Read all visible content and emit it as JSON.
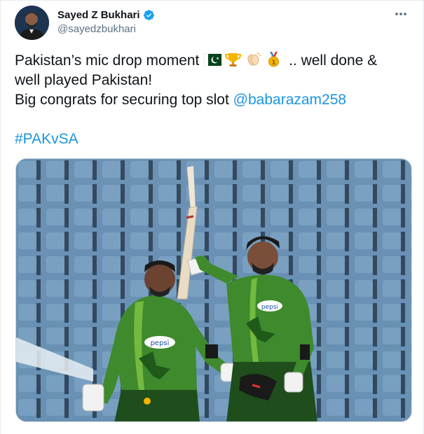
{
  "author": {
    "display_name": "Sayed Z Bukhari",
    "handle": "@sayedzbukhari",
    "verified": true
  },
  "tweet": {
    "line1_text": "Pakistan’s mic drop moment",
    "line1_emojis": [
      "pakistan-flag",
      "trophy",
      "clapping-hands",
      "first-place-medal"
    ],
    "line1_tail": " .. well done &",
    "line2": "well played Pakistan!",
    "line3_text": "Big congrats for securing top slot ",
    "mention": "@babarazam258",
    "hashtag": "#PAKvSA"
  },
  "media": {
    "shirt_brand": "pepsi"
  },
  "colors": {
    "link": "#1b95e0",
    "verified": "#1da1f2",
    "shirt": "#2e6b2a",
    "border": "#e6ecf0"
  }
}
